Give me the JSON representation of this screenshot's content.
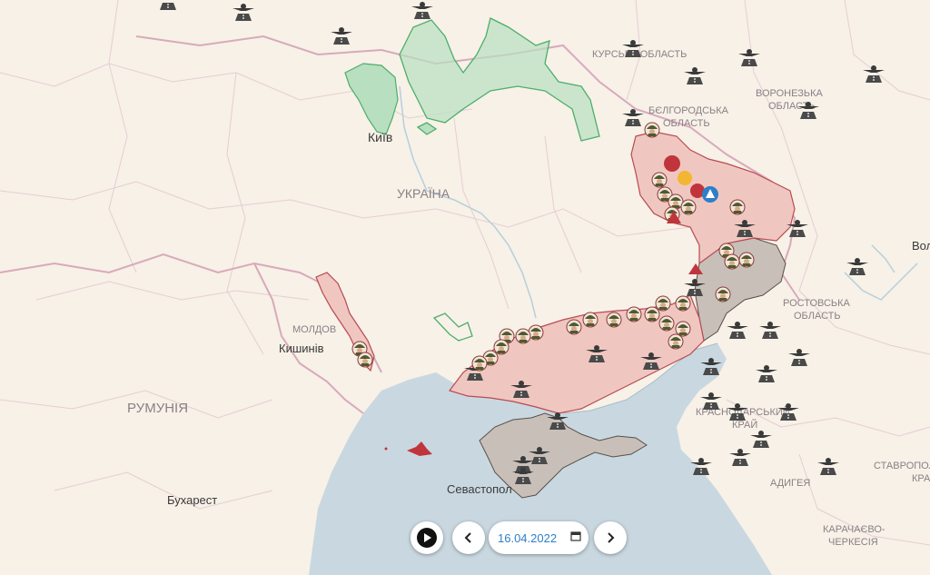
{
  "colors": {
    "land": "#f7f1e7",
    "sea": "#c9d8e0",
    "occupied": "#efc7c0",
    "occupied_border": "#b94a52",
    "pre2022": "#c8bfb9",
    "retreated": "#b8dfc0",
    "retreated_border": "#4cae6b",
    "accent": "#2f7fc7"
  },
  "labels": {
    "kursk": "КУРСЬКА ОБЛАСТЬ",
    "voronezh_1": "ВОРОНЕЗЬКА",
    "voronezh_2": "ОБЛАСТЬ",
    "belgorod_1": "БЄЛГОРОДСЬКА",
    "belgorod_2": "ОБЛАСТЬ",
    "rostov_1": "РОСТОВСЬКА",
    "rostov_2": "ОБЛАСТЬ",
    "krasnodar_1": "КРАСНОДАРСЬКИЙ",
    "krasnodar_2": "КРАЙ",
    "stavropol_1": "СТАВРОПОЛ",
    "stavropol_2": "КРА",
    "adygea": "АДИГЕЯ",
    "karachay_1": "КАРАЧАЄВО-",
    "karachay_2": "ЧЕРКЕСІЯ",
    "ukraine": "УКРАЇНА",
    "moldova": "МОЛДОВ",
    "romania": "РУМУНІЯ",
    "kyiv": "Київ",
    "chisinau": "Кишинів",
    "bucharest": "Бухарест",
    "sevastopol": "Севастопол",
    "volgograd": "Вол"
  },
  "icons": {
    "airfield": "airfield-icon",
    "soldier": "soldier-marker-icon",
    "event": "event-marker-icon",
    "ship": "sunk-ship-icon"
  },
  "controls": {
    "date": "16.04.2022",
    "play_icon": "play-icon",
    "prev_icon": "chevron-left-icon",
    "next_icon": "chevron-right-icon",
    "calendar_icon": "calendar-icon"
  }
}
